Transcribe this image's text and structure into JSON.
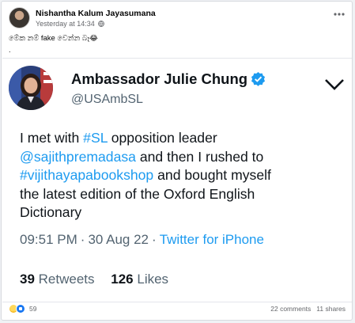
{
  "post": {
    "author": "Nishantha Kalum Jayasumana",
    "timestamp": "Yesterday at 14:34",
    "audience_icon": "globe-icon",
    "caption": "මේක නම් fake වෙන්න බෑ",
    "caption_emoji": "😂",
    "second_line": "."
  },
  "tweet": {
    "name": "Ambassador Julie Chung",
    "handle": "@USAmbSL",
    "text_parts": [
      "I met with ",
      "#SL",
      " opposition leader",
      "@sajithpremadasa",
      " and then I rushed to",
      "#vijithayapabookshop",
      " and bought myself",
      "the latest edition of the Oxford English",
      "Dictionary"
    ],
    "time": "09:51 PM",
    "separator": "·",
    "date": "30 Aug 22",
    "source": "Twitter for iPhone",
    "retweets_count": "39",
    "retweets_label": "Retweets",
    "likes_count": "126",
    "likes_label": "Likes"
  },
  "footer": {
    "reaction_count": "59",
    "comments": "22 comments",
    "shares": "11 shares"
  },
  "colors": {
    "link": "#1d9bf0",
    "verified": "#1d9bf0",
    "secondary_text": "#536471"
  }
}
